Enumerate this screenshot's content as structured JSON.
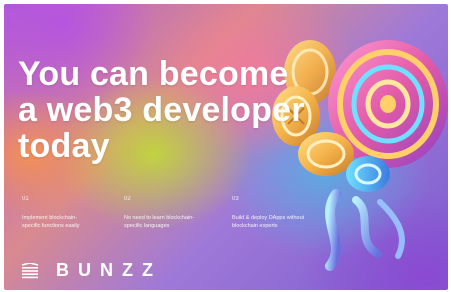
{
  "headline": {
    "line1": "You can become",
    "line2": "a web3 developer",
    "line3": "today"
  },
  "features": [
    {
      "number": "01",
      "text_line1": "Implement blockchain-",
      "text_line2": "specific functions easily"
    },
    {
      "number": "02",
      "text_line1": "No need to learn blockchain-",
      "text_line2": "specific languages"
    },
    {
      "number": "03",
      "text_line1": "Build & deploy DApps without",
      "text_line2": "blockchain experts"
    }
  ],
  "brand": {
    "name": "BUNZZ",
    "logo_icon": "bunzz-logo-icon"
  },
  "colors": {
    "text": "#ffffff",
    "accent_purple": "#9b5de5",
    "accent_lime": "#c3e32a",
    "accent_pink": "#ff7a9a",
    "accent_cyan": "#4cc3e6"
  },
  "decoration": {
    "icon": "3d-coins-illustration"
  }
}
